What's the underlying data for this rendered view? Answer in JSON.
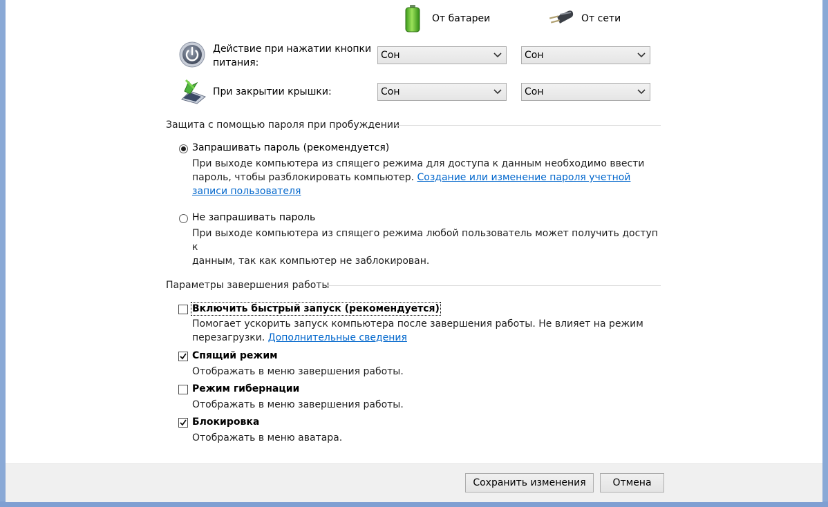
{
  "columns": {
    "battery": "От батареи",
    "ac": "От сети"
  },
  "power_button": {
    "label_line1": "Действие при нажатии кнопки",
    "label_line2": "питания:",
    "battery_value": "Сон",
    "ac_value": "Сон"
  },
  "lid_close": {
    "label": "При закрытии крышки:",
    "battery_value": "Сон",
    "ac_value": "Сон"
  },
  "password_section": {
    "title": "Защита с помощью пароля при пробуждении",
    "require": {
      "label": "Запрашивать пароль (рекомендуется)",
      "selected": true,
      "desc_line1": "При выходе компьютера из спящего режима для доступа к данным необходимо ввести",
      "desc_line2_text": "пароль, чтобы разблокировать компьютер. ",
      "desc_line2_link": "Создание или изменение пароля учетной",
      "desc_line3_link": "записи пользователя"
    },
    "no_require": {
      "label": "Не запрашивать пароль",
      "selected": false,
      "desc_line1": "При выходе компьютера из спящего режима любой пользователь может получить доступ к",
      "desc_line2": "данным, так как компьютер не заблокирован."
    }
  },
  "shutdown_section": {
    "title": "Параметры завершения работы",
    "fast_startup": {
      "label": "Включить быстрый запуск (рекомендуется)",
      "checked": false,
      "desc_line1": "Помогает ускорить запуск компьютера после завершения работы. Не влияет на режим",
      "desc_line2_text": "перезагрузки. ",
      "desc_line2_link": "Дополнительные сведения"
    },
    "sleep": {
      "label": "Спящий режим",
      "checked": true,
      "desc": "Отображать в меню завершения работы."
    },
    "hibernate": {
      "label": "Режим гибернации",
      "checked": false,
      "desc": "Отображать в меню завершения работы."
    },
    "lock": {
      "label": "Блокировка",
      "checked": true,
      "desc": "Отображать в меню аватара."
    }
  },
  "footer": {
    "save": "Сохранить изменения",
    "cancel": "Отмена"
  },
  "colors": {
    "frame": "#8aa9d6",
    "link": "#0066cc",
    "footer_bg": "#f0f0f0"
  }
}
